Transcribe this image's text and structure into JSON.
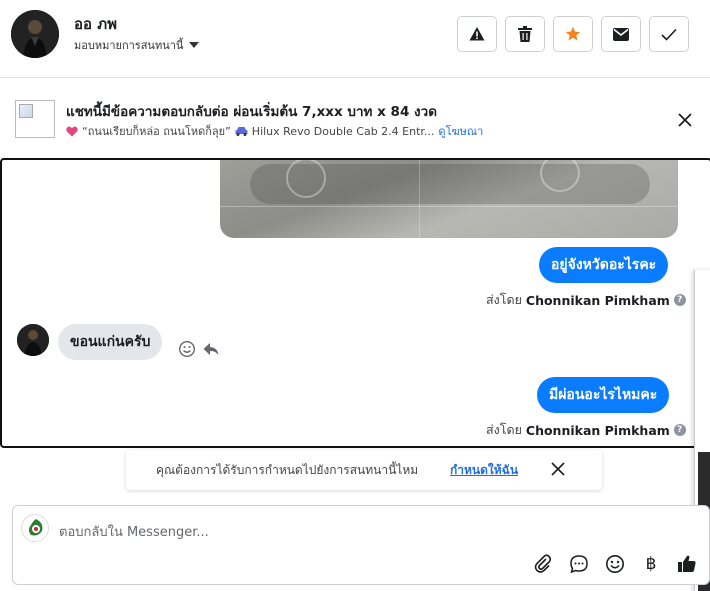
{
  "header": {
    "user_name": "ออ ภพ",
    "assign_label": "มอบหมายการสนทนานี้",
    "buttons": [
      "alert-icon",
      "trash-icon",
      "star-icon",
      "envelope-icon",
      "check-icon"
    ],
    "star_color": "#f5831f"
  },
  "ad": {
    "title": "แชทนี้มีข้อความตอบกลับต่อ ผ่อนเริ่มต้น 7,xxx บาท x 84 งวด",
    "subtitle": "“ถนนเรียบก็หล่อ ถนนโหดก็ลุย”",
    "model": "Hilux Revo Double Cab 2.4 Entr...",
    "view_ad": "ดูโฆษณา"
  },
  "messages": {
    "out1": "อยู่จังหวัดอะไรคะ",
    "sent_by_1_prefix": "ส่งโดย",
    "sent_by_1_name": "Chonnikan Pimkham",
    "in1": "ขอนแก่นครับ",
    "out2": "มีผ่อนอะไรไหมคะ",
    "sent_by_2_prefix": "ส่งโดย",
    "sent_by_2_name": "Chonnikan Pimkham",
    "accent": "#0a7cff"
  },
  "reminder": {
    "text": "คุณต้องการได้รับการกำหนดไปยังการสนทนานี้ไหม",
    "link": "กำหนดให้ฉัน"
  },
  "composer": {
    "placeholder": "ตอบกลับใน Messenger...",
    "tools": [
      "paperclip-icon",
      "chat-bubble-icon",
      "emoji-icon",
      "baht-icon",
      "thumbs-up-icon"
    ],
    "baht_symbol": "฿"
  }
}
